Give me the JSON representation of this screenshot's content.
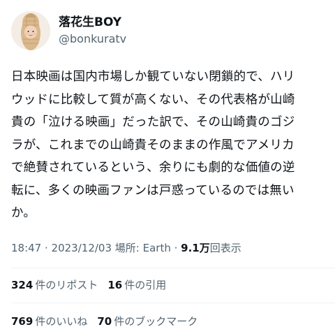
{
  "author": {
    "display_name": "落花生BOY",
    "handle": "@bonkuratv",
    "avatar_icon": "baby-in-peanut-hood-avatar"
  },
  "tweet": {
    "lines": [
      "日本映画は国内市場しか観ていない閉鎖的で、ハリ",
      "ウッドに比較して質が高くない、その代表格が山崎",
      "貴の「泣ける映画」だった訳で、その山崎貴のゴジ",
      "ラが、これまでの山崎貴そのままの作風でアメリカ",
      "で絶賛されているという、余りにも劇的な価値の逆",
      "転に、多くの映画ファンは戸惑っているのでは無い",
      "か。"
    ]
  },
  "meta": {
    "time": "18:47",
    "sep1": " · ",
    "date": "2023/12/03",
    "location": " 場所: Earth",
    "sep2": " · ",
    "views_count": "9.1万",
    "views_label": "回表示"
  },
  "stats": {
    "reposts_count": "324",
    "reposts_label": "件のリポスト",
    "quotes_count": "16",
    "quotes_label": "件の引用",
    "likes_count": "769",
    "likes_label": "件のいいね",
    "bookmarks_count": "70",
    "bookmarks_label": "件のブックマーク"
  },
  "colors": {
    "text_primary": "#0f1419",
    "text_secondary": "#536471",
    "divider": "#eff3f4"
  }
}
